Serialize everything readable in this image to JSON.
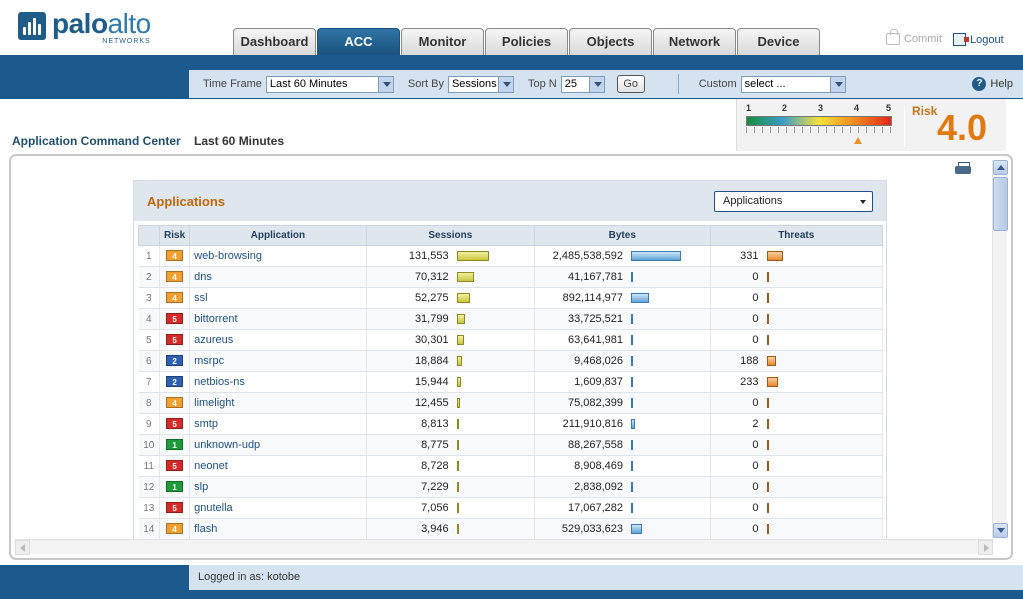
{
  "logo": {
    "brand_bold": "palo",
    "brand_light": "alto",
    "sub": "NETWORKS"
  },
  "tabs": [
    {
      "label": "Dashboard",
      "active": false
    },
    {
      "label": "ACC",
      "active": true
    },
    {
      "label": "Monitor",
      "active": false
    },
    {
      "label": "Policies",
      "active": false
    },
    {
      "label": "Objects",
      "active": false
    },
    {
      "label": "Network",
      "active": false
    },
    {
      "label": "Device",
      "active": false
    }
  ],
  "header": {
    "commit_label": "Commit",
    "logout_label": "Logout"
  },
  "filters": {
    "time_frame_label": "Time Frame",
    "time_frame_value": "Last 60 Minutes",
    "sort_by_label": "Sort By",
    "sort_by_value": "Sessions",
    "top_n_label": "Top N",
    "top_n_value": "25",
    "go_label": "Go",
    "custom_label": "Custom",
    "custom_value": "select ...",
    "help_label": "Help"
  },
  "page": {
    "title": "Application Command Center",
    "range": "Last 60 Minutes"
  },
  "risk": {
    "scale": [
      "1",
      "2",
      "3",
      "4",
      "5"
    ],
    "label": "Risk",
    "value": "4.0"
  },
  "widget": {
    "title": "Applications",
    "select_value": "Applications",
    "columns": [
      "Risk",
      "Application",
      "Sessions",
      "Bytes",
      "Threats"
    ]
  },
  "risk_colors": {
    "1": "#1e9a3a",
    "2": "#2f5fb0",
    "4": "#f0a030",
    "5": "#d42a2a"
  },
  "apps": [
    {
      "n": "1",
      "risk": "4",
      "name": "web-browsing",
      "sessions": "131,553",
      "bytes": "2,485,538,592",
      "threats": "331",
      "sv": 131553,
      "bv": 2485538592,
      "tv": 331
    },
    {
      "n": "2",
      "risk": "4",
      "name": "dns",
      "sessions": "70,312",
      "bytes": "41,167,781",
      "threats": "0",
      "sv": 70312,
      "bv": 41167781,
      "tv": 0
    },
    {
      "n": "3",
      "risk": "4",
      "name": "ssl",
      "sessions": "52,275",
      "bytes": "892,114,977",
      "threats": "0",
      "sv": 52275,
      "bv": 892114977,
      "tv": 0
    },
    {
      "n": "4",
      "risk": "5",
      "name": "bittorrent",
      "sessions": "31,799",
      "bytes": "33,725,521",
      "threats": "0",
      "sv": 31799,
      "bv": 33725521,
      "tv": 0
    },
    {
      "n": "5",
      "risk": "5",
      "name": "azureus",
      "sessions": "30,301",
      "bytes": "63,641,981",
      "threats": "0",
      "sv": 30301,
      "bv": 63641981,
      "tv": 0
    },
    {
      "n": "6",
      "risk": "2",
      "name": "msrpc",
      "sessions": "18,884",
      "bytes": "9,468,026",
      "threats": "188",
      "sv": 18884,
      "bv": 9468026,
      "tv": 188
    },
    {
      "n": "7",
      "risk": "2",
      "name": "netbios-ns",
      "sessions": "15,944",
      "bytes": "1,609,837",
      "threats": "233",
      "sv": 15944,
      "bv": 1609837,
      "tv": 233
    },
    {
      "n": "8",
      "risk": "4",
      "name": "limelight",
      "sessions": "12,455",
      "bytes": "75,082,399",
      "threats": "0",
      "sv": 12455,
      "bv": 75082399,
      "tv": 0
    },
    {
      "n": "9",
      "risk": "5",
      "name": "smtp",
      "sessions": "8,813",
      "bytes": "211,910,816",
      "threats": "2",
      "sv": 8813,
      "bv": 211910816,
      "tv": 2
    },
    {
      "n": "10",
      "risk": "1",
      "name": "unknown-udp",
      "sessions": "8,775",
      "bytes": "88,267,558",
      "threats": "0",
      "sv": 8775,
      "bv": 88267558,
      "tv": 0
    },
    {
      "n": "11",
      "risk": "5",
      "name": "neonet",
      "sessions": "8,728",
      "bytes": "8,908,469",
      "threats": "0",
      "sv": 8728,
      "bv": 8908469,
      "tv": 0
    },
    {
      "n": "12",
      "risk": "1",
      "name": "slp",
      "sessions": "7,229",
      "bytes": "2,838,092",
      "threats": "0",
      "sv": 7229,
      "bv": 2838092,
      "tv": 0
    },
    {
      "n": "13",
      "risk": "5",
      "name": "gnutella",
      "sessions": "7,056",
      "bytes": "17,067,282",
      "threats": "0",
      "sv": 7056,
      "bv": 17067282,
      "tv": 0
    },
    {
      "n": "14",
      "risk": "4",
      "name": "flash",
      "sessions": "3,946",
      "bytes": "529,033,623",
      "threats": "0",
      "sv": 3946,
      "bv": 529033623,
      "tv": 0
    }
  ],
  "footer": {
    "logged_in": "Logged in as: kotobe"
  }
}
